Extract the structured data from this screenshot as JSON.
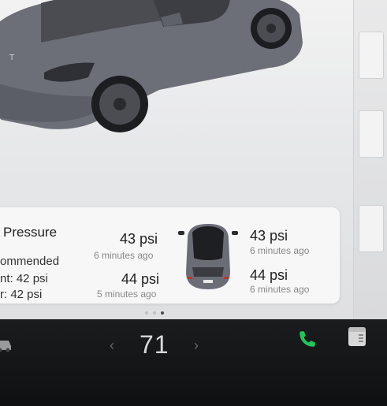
{
  "tire_pressure": {
    "title": "Pressure",
    "recommended_label": "ommended",
    "front_recommended": "nt: 42 psi",
    "rear_recommended": "r: 42 psi",
    "tires": {
      "front_left": {
        "pressure": "43 psi",
        "updated": "6 minutes ago"
      },
      "front_right": {
        "pressure": "43 psi",
        "updated": "6 minutes ago"
      },
      "rear_left": {
        "pressure": "44 psi",
        "updated": "5 minutes ago"
      },
      "rear_right": {
        "pressure": "44 psi",
        "updated": "6 minutes ago"
      }
    },
    "pager": {
      "pages": 3,
      "active": 3
    }
  },
  "climate": {
    "temperature": "71",
    "decrease_symbol": "‹",
    "increase_symbol": "›"
  },
  "icons": {
    "car": "car-icon",
    "phone": "phone-icon",
    "app": "app-launcher-icon"
  },
  "colors": {
    "phone_green": "#21c55d",
    "bar_background": "#151617",
    "card_background": "#f7f7f8"
  }
}
